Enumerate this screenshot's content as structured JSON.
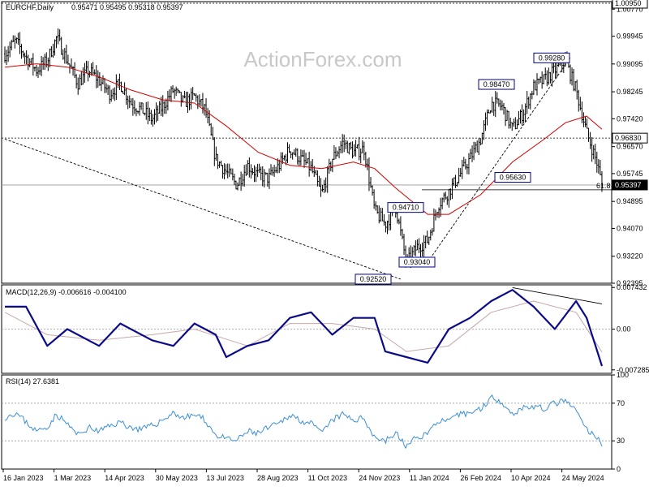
{
  "header": {
    "title": "EURCHF,Daily",
    "ohlc": "0.95471 0.95495 0.95318 0.95397"
  },
  "watermark": "ActionForex.com",
  "colors": {
    "price": "#000000",
    "ma": "#d40000",
    "macd": "#0b0b8a",
    "signal": "#c8a8a8",
    "rsi": "#3d8fd6",
    "axis_box": "#000000",
    "label_box": "#00008b"
  },
  "chart_data": [
    {
      "type": "ohlc",
      "name": "price-panel",
      "ylim": [
        0.92395,
        1.01
      ],
      "y_ticks": [
        "1.00950",
        "1.00770",
        "0.99945",
        "0.99095",
        "0.98245",
        "0.97420",
        "0.96570",
        "0.95745",
        "0.94895",
        "0.94070",
        "0.93220",
        "0.92395"
      ],
      "current_price": "0.95397",
      "current_price_value": 0.95397,
      "resistance_label": "0.96830",
      "resistance_value": 0.9683,
      "top_level_label": "1.00950",
      "top_level_value": 1.0095,
      "fib_label": "61.8",
      "fib_value": 0.9525,
      "annotations": [
        {
          "label": "0.99280",
          "value": 0.9928
        },
        {
          "label": "0.98470",
          "value": 0.9847
        },
        {
          "label": "0.95630",
          "value": 0.9563
        },
        {
          "label": "0.94710",
          "value": 0.9471
        },
        {
          "label": "0.93040",
          "value": 0.9304
        },
        {
          "label": "0.92520",
          "value": 0.9252
        }
      ],
      "x_labels": [
        "16 Jan 2023",
        "1 Mar 2023",
        "14 Apr 2023",
        "30 May 2023",
        "13 Jul 2023",
        "28 Aug 2023",
        "11 Oct 2023",
        "24 Nov 2023",
        "11 Jan 2024",
        "26 Feb 2024",
        "10 Apr 2024",
        "24 May 2024"
      ],
      "close_path": [
        [
          "2023-01-16",
          0.994
        ],
        [
          "2023-01-25",
          0.998
        ],
        [
          "2023-02-03",
          0.993
        ],
        [
          "2023-02-12",
          0.989
        ],
        [
          "2023-02-21",
          0.992
        ],
        [
          "2023-03-01",
          0.999
        ],
        [
          "2023-03-10",
          0.992
        ],
        [
          "2023-03-19",
          0.985
        ],
        [
          "2023-03-28",
          0.989
        ],
        [
          "2023-04-06",
          0.986
        ],
        [
          "2023-04-15",
          0.982
        ],
        [
          "2023-04-24",
          0.985
        ],
        [
          "2023-05-03",
          0.979
        ],
        [
          "2023-05-12",
          0.977
        ],
        [
          "2023-05-21",
          0.974
        ],
        [
          "2023-05-30",
          0.978
        ],
        [
          "2023-06-08",
          0.983
        ],
        [
          "2023-06-17",
          0.979
        ],
        [
          "2023-06-26",
          0.981
        ],
        [
          "2023-07-05",
          0.977
        ],
        [
          "2023-07-14",
          0.962
        ],
        [
          "2023-07-23",
          0.958
        ],
        [
          "2023-08-01",
          0.954
        ],
        [
          "2023-08-10",
          0.96
        ],
        [
          "2023-08-19",
          0.957
        ],
        [
          "2023-08-28",
          0.956
        ],
        [
          "2023-09-06",
          0.96
        ],
        [
          "2023-09-15",
          0.965
        ],
        [
          "2023-09-24",
          0.962
        ],
        [
          "2023-10-03",
          0.959
        ],
        [
          "2023-10-12",
          0.951
        ],
        [
          "2023-10-21",
          0.962
        ],
        [
          "2023-10-30",
          0.967
        ],
        [
          "2023-11-08",
          0.964
        ],
        [
          "2023-11-17",
          0.965
        ],
        [
          "2023-11-26",
          0.946
        ],
        [
          "2023-12-05",
          0.942
        ],
        [
          "2023-12-14",
          0.947
        ],
        [
          "2023-12-23",
          0.93
        ],
        [
          "2024-01-01",
          0.935
        ],
        [
          "2024-01-10",
          0.937
        ],
        [
          "2024-01-19",
          0.948
        ],
        [
          "2024-01-28",
          0.952
        ],
        [
          "2024-02-06",
          0.957
        ],
        [
          "2024-02-15",
          0.962
        ],
        [
          "2024-02-24",
          0.968
        ],
        [
          "2024-03-04",
          0.979
        ],
        [
          "2024-03-13",
          0.978
        ],
        [
          "2024-03-22",
          0.971
        ],
        [
          "2024-03-31",
          0.976
        ],
        [
          "2024-04-09",
          0.984
        ],
        [
          "2024-04-18",
          0.986
        ],
        [
          "2024-04-27",
          0.989
        ],
        [
          "2024-05-06",
          0.992
        ],
        [
          "2024-05-15",
          0.983
        ],
        [
          "2024-05-24",
          0.97
        ],
        [
          "2024-06-02",
          0.9605
        ],
        [
          "2024-06-06",
          0.954
        ]
      ],
      "ma_path": [
        [
          "2023-01-16",
          0.99
        ],
        [
          "2023-02-12",
          0.991
        ],
        [
          "2023-03-10",
          0.99
        ],
        [
          "2023-04-06",
          0.987
        ],
        [
          "2023-05-03",
          0.983
        ],
        [
          "2023-05-30",
          0.98
        ],
        [
          "2023-06-26",
          0.979
        ],
        [
          "2023-07-23",
          0.972
        ],
        [
          "2023-08-19",
          0.964
        ],
        [
          "2023-09-15",
          0.96
        ],
        [
          "2023-10-12",
          0.959
        ],
        [
          "2023-11-08",
          0.961
        ],
        [
          "2023-11-26",
          0.959
        ],
        [
          "2023-12-14",
          0.953
        ],
        [
          "2024-01-10",
          0.945
        ],
        [
          "2024-01-28",
          0.945
        ],
        [
          "2024-02-24",
          0.951
        ],
        [
          "2024-03-22",
          0.961
        ],
        [
          "2024-04-18",
          0.968
        ],
        [
          "2024-05-06",
          0.973
        ],
        [
          "2024-05-24",
          0.975
        ],
        [
          "2024-06-06",
          0.971
        ]
      ],
      "trendline_1": [
        [
          "2023-01-16",
          0.968
        ],
        [
          "2023-12-18",
          0.9252
        ]
      ],
      "trendline_2": [
        [
          "2024-01-10",
          0.9304
        ],
        [
          "2024-05-10",
          0.9928
        ]
      ]
    },
    {
      "type": "line",
      "name": "macd-panel",
      "title": "MACD(12,26,9) -0.006616 -0.004100",
      "ylim": [
        -0.0079,
        0.0079
      ],
      "y_ticks": [
        "0.007432",
        "0.00",
        "-0.007285"
      ],
      "series": [
        {
          "name": "macd",
          "points": [
            [
              "2023-01-16",
              0.004
            ],
            [
              "2023-02-03",
              0.004
            ],
            [
              "2023-02-21",
              -0.003
            ],
            [
              "2023-03-10",
              0.0
            ],
            [
              "2023-04-06",
              -0.003
            ],
            [
              "2023-04-24",
              0.001
            ],
            [
              "2023-05-21",
              -0.002
            ],
            [
              "2023-06-08",
              -0.003
            ],
            [
              "2023-06-26",
              0.001
            ],
            [
              "2023-07-14",
              -0.001
            ],
            [
              "2023-07-23",
              -0.005
            ],
            [
              "2023-08-10",
              -0.003
            ],
            [
              "2023-08-28",
              -0.002
            ],
            [
              "2023-09-15",
              0.002
            ],
            [
              "2023-10-03",
              0.003
            ],
            [
              "2023-10-21",
              -0.001
            ],
            [
              "2023-11-08",
              0.002
            ],
            [
              "2023-11-26",
              0.002
            ],
            [
              "2023-12-05",
              -0.004
            ],
            [
              "2023-12-23",
              -0.005
            ],
            [
              "2024-01-10",
              -0.006
            ],
            [
              "2024-01-28",
              0.0
            ],
            [
              "2024-02-15",
              0.002
            ],
            [
              "2024-03-04",
              0.005
            ],
            [
              "2024-03-22",
              0.007
            ],
            [
              "2024-04-09",
              0.004
            ],
            [
              "2024-04-27",
              0.0
            ],
            [
              "2024-05-15",
              0.005
            ],
            [
              "2024-05-24",
              0.002
            ],
            [
              "2024-06-06",
              -0.0066
            ]
          ]
        },
        {
          "name": "signal",
          "points": [
            [
              "2023-01-16",
              0.003
            ],
            [
              "2023-02-21",
              -0.001
            ],
            [
              "2023-04-06",
              -0.002
            ],
            [
              "2023-05-21",
              -0.001
            ],
            [
              "2023-06-26",
              0.0
            ],
            [
              "2023-08-10",
              -0.003
            ],
            [
              "2023-09-15",
              0.001
            ],
            [
              "2023-10-21",
              0.001
            ],
            [
              "2023-11-26",
              0.0
            ],
            [
              "2023-12-23",
              -0.004
            ],
            [
              "2024-01-28",
              -0.003
            ],
            [
              "2024-03-04",
              0.003
            ],
            [
              "2024-04-09",
              0.005
            ],
            [
              "2024-05-15",
              0.003
            ],
            [
              "2024-06-06",
              -0.0041
            ]
          ]
        }
      ],
      "trendline": [
        [
          "2024-03-22",
          0.0074
        ],
        [
          "2024-06-06",
          0.0045
        ]
      ]
    },
    {
      "type": "line",
      "name": "rsi-panel",
      "title": "RSI(14) 27.6381",
      "ylim": [
        0,
        100
      ],
      "y_ticks": [
        "100",
        "70",
        "30",
        "0"
      ],
      "levels": [
        70,
        30
      ],
      "series": [
        {
          "name": "rsi",
          "points": [
            [
              "2023-01-16",
              55
            ],
            [
              "2023-01-25",
              60
            ],
            [
              "2023-02-03",
              50
            ],
            [
              "2023-02-12",
              40
            ],
            [
              "2023-02-21",
              45
            ],
            [
              "2023-03-01",
              58
            ],
            [
              "2023-03-10",
              48
            ],
            [
              "2023-03-19",
              36
            ],
            [
              "2023-03-28",
              44
            ],
            [
              "2023-04-06",
              40
            ],
            [
              "2023-04-15",
              46
            ],
            [
              "2023-04-24",
              50
            ],
            [
              "2023-05-03",
              44
            ],
            [
              "2023-05-12",
              42
            ],
            [
              "2023-05-21",
              46
            ],
            [
              "2023-05-30",
              52
            ],
            [
              "2023-06-08",
              60
            ],
            [
              "2023-06-17",
              54
            ],
            [
              "2023-06-26",
              58
            ],
            [
              "2023-07-05",
              52
            ],
            [
              "2023-07-14",
              36
            ],
            [
              "2023-07-23",
              32
            ],
            [
              "2023-08-01",
              30
            ],
            [
              "2023-08-10",
              40
            ],
            [
              "2023-08-19",
              38
            ],
            [
              "2023-08-28",
              44
            ],
            [
              "2023-09-06",
              48
            ],
            [
              "2023-09-15",
              58
            ],
            [
              "2023-09-24",
              52
            ],
            [
              "2023-10-03",
              48
            ],
            [
              "2023-10-12",
              38
            ],
            [
              "2023-10-21",
              52
            ],
            [
              "2023-10-30",
              58
            ],
            [
              "2023-11-08",
              52
            ],
            [
              "2023-11-17",
              54
            ],
            [
              "2023-11-26",
              34
            ],
            [
              "2023-12-05",
              30
            ],
            [
              "2023-12-14",
              38
            ],
            [
              "2023-12-23",
              24
            ],
            [
              "2024-01-01",
              34
            ],
            [
              "2024-01-10",
              38
            ],
            [
              "2024-01-19",
              52
            ],
            [
              "2024-01-28",
              50
            ],
            [
              "2024-02-06",
              58
            ],
            [
              "2024-02-15",
              60
            ],
            [
              "2024-02-24",
              64
            ],
            [
              "2024-03-04",
              76
            ],
            [
              "2024-03-13",
              72
            ],
            [
              "2024-03-22",
              58
            ],
            [
              "2024-03-31",
              66
            ],
            [
              "2024-04-09",
              66
            ],
            [
              "2024-04-18",
              64
            ],
            [
              "2024-04-27",
              70
            ],
            [
              "2024-05-06",
              72
            ],
            [
              "2024-05-15",
              62
            ],
            [
              "2024-05-24",
              42
            ],
            [
              "2024-06-02",
              32
            ],
            [
              "2024-06-06",
              27.6
            ]
          ]
        }
      ]
    }
  ]
}
